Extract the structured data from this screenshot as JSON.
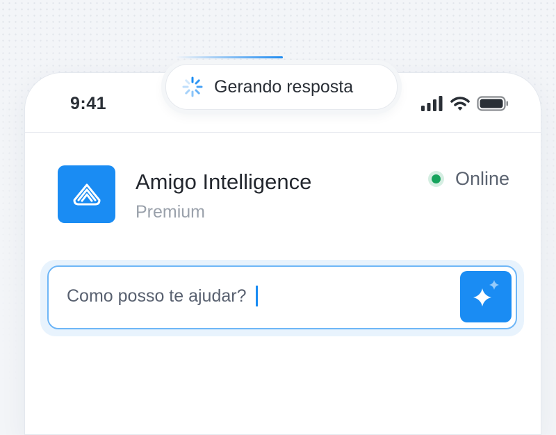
{
  "status_bar": {
    "time": "9:41",
    "icons": [
      "cellular-signal-icon",
      "wifi-icon",
      "battery-icon"
    ]
  },
  "activity_island": {
    "label": "Gerando resposta",
    "icon": "loading-spinner-icon"
  },
  "assistant": {
    "name": "Amigo Intelligence",
    "tier": "Premium",
    "logo_icon": "amigo-logo-icon",
    "status": "Online",
    "status_color": "#16a35c"
  },
  "composer": {
    "placeholder": "Como posso te ajudar?",
    "button_icon": "sparkles-icon"
  },
  "colors": {
    "accent": "#1a8cf3",
    "text_primary": "#23272e",
    "text_muted": "#9aa1ab",
    "background": "#f3f5f8"
  }
}
